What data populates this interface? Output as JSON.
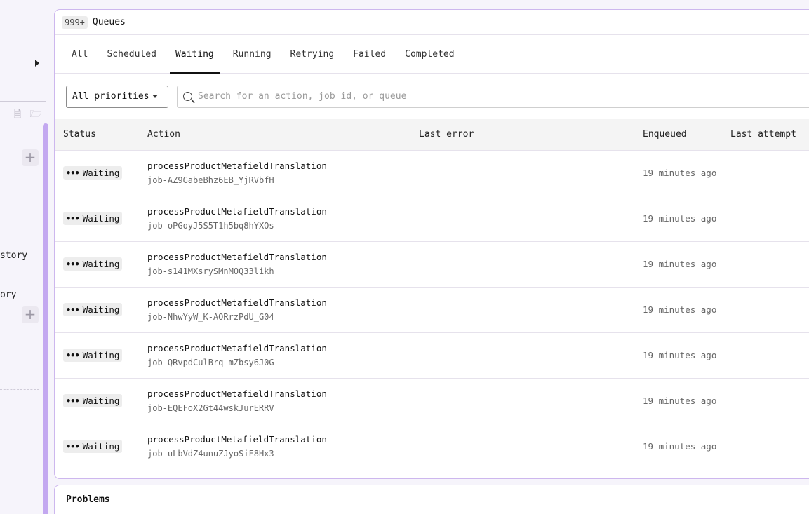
{
  "sidebar": {
    "text_1": "story",
    "text_2": "ory"
  },
  "header": {
    "count": "999+",
    "title": "Queues"
  },
  "tabs": [
    {
      "label": "All"
    },
    {
      "label": "Scheduled"
    },
    {
      "label": "Waiting"
    },
    {
      "label": "Running"
    },
    {
      "label": "Retrying"
    },
    {
      "label": "Failed"
    },
    {
      "label": "Completed"
    }
  ],
  "filters": {
    "priority_value": "All priorities",
    "search_placeholder": "Search for an action, job id, or queue"
  },
  "table": {
    "columns": [
      "Status",
      "Action",
      "Last error",
      "Enqueued",
      "Last attempt"
    ],
    "rows": [
      {
        "status": "Waiting",
        "action": "processProductMetafieldTranslation",
        "job_id": "job-AZ9GabeBhz6EB_YjRVbfH",
        "last_error": "",
        "enqueued": "19 minutes ago",
        "last_attempt": ""
      },
      {
        "status": "Waiting",
        "action": "processProductMetafieldTranslation",
        "job_id": "job-oPGoyJ5S5T1h5bq8hYXOs",
        "last_error": "",
        "enqueued": "19 minutes ago",
        "last_attempt": ""
      },
      {
        "status": "Waiting",
        "action": "processProductMetafieldTranslation",
        "job_id": "job-s141MXsrySMnMOQ33likh",
        "last_error": "",
        "enqueued": "19 minutes ago",
        "last_attempt": ""
      },
      {
        "status": "Waiting",
        "action": "processProductMetafieldTranslation",
        "job_id": "job-NhwYyW_K-AORrzPdU_G04",
        "last_error": "",
        "enqueued": "19 minutes ago",
        "last_attempt": ""
      },
      {
        "status": "Waiting",
        "action": "processProductMetafieldTranslation",
        "job_id": "job-QRvpdCulBrq_mZbsy6J0G",
        "last_error": "",
        "enqueued": "19 minutes ago",
        "last_attempt": ""
      },
      {
        "status": "Waiting",
        "action": "processProductMetafieldTranslation",
        "job_id": "job-EQEFoX2Gt44wskJurERRV",
        "last_error": "",
        "enqueued": "19 minutes ago",
        "last_attempt": ""
      },
      {
        "status": "Waiting",
        "action": "processProductMetafieldTranslation",
        "job_id": "job-uLbVdZ4unuZJyoSiF8Hx3",
        "last_error": "",
        "enqueued": "19 minutes ago",
        "last_attempt": ""
      }
    ]
  },
  "problems": {
    "title": "Problems"
  },
  "colors": {
    "accent": "#c3a8f0",
    "panel_border": "#cdb7ee",
    "background": "#f6f4fb"
  }
}
